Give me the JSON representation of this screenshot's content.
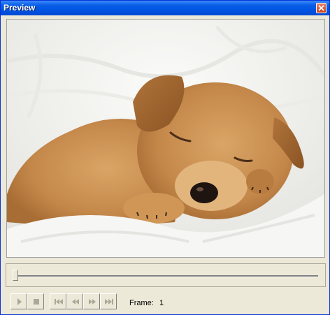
{
  "window": {
    "title": "Preview",
    "close_icon": "close-icon"
  },
  "preview": {
    "image_subject": "sleeping puppy on white blanket"
  },
  "timeline": {
    "position": 0
  },
  "controls": {
    "buttons": [
      {
        "icon": "play-icon"
      },
      {
        "icon": "stop-icon"
      },
      {
        "icon": "skip-to-start-icon"
      },
      {
        "icon": "rewind-icon"
      },
      {
        "icon": "fast-forward-icon"
      },
      {
        "icon": "skip-to-end-icon"
      }
    ]
  },
  "frame": {
    "label": "Frame:",
    "value": "1"
  },
  "colors": {
    "titlebar": "#0054e3",
    "face": "#ece9d8",
    "disabled_icon": "#aca899"
  }
}
